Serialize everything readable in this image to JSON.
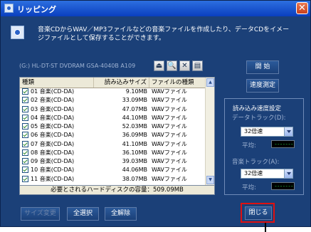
{
  "window": {
    "title": "リッピング",
    "close_glyph": "✕"
  },
  "description": "音楽CDからWAV／MP3ファイルなどの音楽ファイルを作成したり、データCDをイメージファイルとして保存することができます。",
  "drive": {
    "label": "(G:) HL-DT-ST DVDRAM GSA-4040B A109",
    "tool_icons": [
      "eject-icon",
      "search-icon",
      "refresh-search-icon",
      "info-icon"
    ],
    "tool_glyphs": [
      "⏏",
      "🔍",
      "✕",
      "▤"
    ]
  },
  "buttons": {
    "start": "開 始",
    "measure_speed": "速度測定",
    "size_change": "サイズ変更",
    "select_all": "全選択",
    "deselect_all": "全解除",
    "close": "閉じる"
  },
  "table": {
    "columns": [
      "種類",
      "読み込みサイズ",
      "ファイルの種類"
    ],
    "rows": [
      {
        "checked": true,
        "name": "01 音楽(CD-DA)",
        "size": "9.10MB",
        "type": "WAVファイル"
      },
      {
        "checked": true,
        "name": "02 音楽(CD-DA)",
        "size": "33.09MB",
        "type": "WAVファイル"
      },
      {
        "checked": true,
        "name": "03 音楽(CD-DA)",
        "size": "47.07MB",
        "type": "WAVファイル"
      },
      {
        "checked": true,
        "name": "04 音楽(CD-DA)",
        "size": "44.10MB",
        "type": "WAVファイル"
      },
      {
        "checked": true,
        "name": "05 音楽(CD-DA)",
        "size": "52.03MB",
        "type": "WAVファイル"
      },
      {
        "checked": true,
        "name": "06 音楽(CD-DA)",
        "size": "36.09MB",
        "type": "WAVファイル"
      },
      {
        "checked": true,
        "name": "07 音楽(CD-DA)",
        "size": "41.10MB",
        "type": "WAVファイル"
      },
      {
        "checked": true,
        "name": "08 音楽(CD-DA)",
        "size": "36.10MB",
        "type": "WAVファイル"
      },
      {
        "checked": true,
        "name": "09 音楽(CD-DA)",
        "size": "39.03MB",
        "type": "WAVファイル"
      },
      {
        "checked": true,
        "name": "10 音楽(CD-DA)",
        "size": "44.06MB",
        "type": "WAVファイル"
      },
      {
        "checked": true,
        "name": "11 音楽(CD-DA)",
        "size": "38.07MB",
        "type": "WAVファイル"
      }
    ],
    "footer": "必要とされるハードディスクの容量：509.09MB"
  },
  "speed": {
    "title": "読み込み速度設定",
    "data_track_label": "データトラック(D):",
    "data_track_value": "32倍速",
    "data_avg_label": "平均:",
    "data_avg_value": "-------",
    "audio_track_label": "音楽トラック(A):",
    "audio_track_value": "32倍速",
    "audio_avg_label": "平均:",
    "audio_avg_value": "-------"
  }
}
